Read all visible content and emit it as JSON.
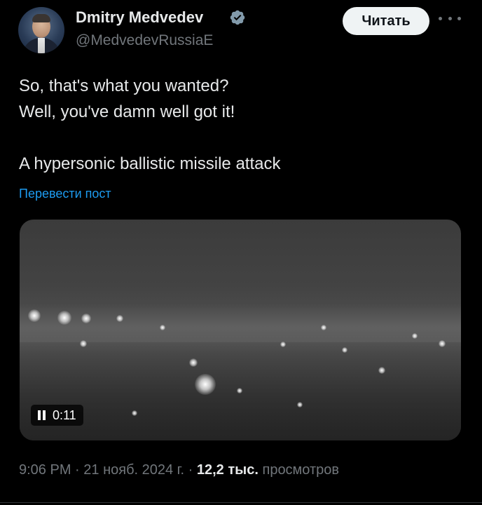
{
  "author": {
    "name": "Dmitry Medvedev",
    "handle": "@MedvedevRussiaE",
    "verified": true,
    "avatar_icon": "avatar-portrait"
  },
  "actions": {
    "follow_label": "Читать",
    "more_icon": "more-dots-icon"
  },
  "tweet": {
    "lines": [
      "So, that's what you wanted?",
      "Well, you've damn well got it!",
      "",
      "A hypersonic ballistic missile attack"
    ],
    "translate_label": "Перевести пост"
  },
  "media": {
    "type": "video",
    "state": "playing",
    "timecode": "0:11"
  },
  "meta": {
    "time": "9:06 PM",
    "date": "21 нояб. 2024 г.",
    "separator": " · ",
    "views_count": "12,2 тыс.",
    "views_label": "просмотров"
  },
  "colors": {
    "background": "#000000",
    "text": "#e7e9ea",
    "secondary": "#71767b",
    "link": "#1d9bf0",
    "verified": "#829aab"
  }
}
